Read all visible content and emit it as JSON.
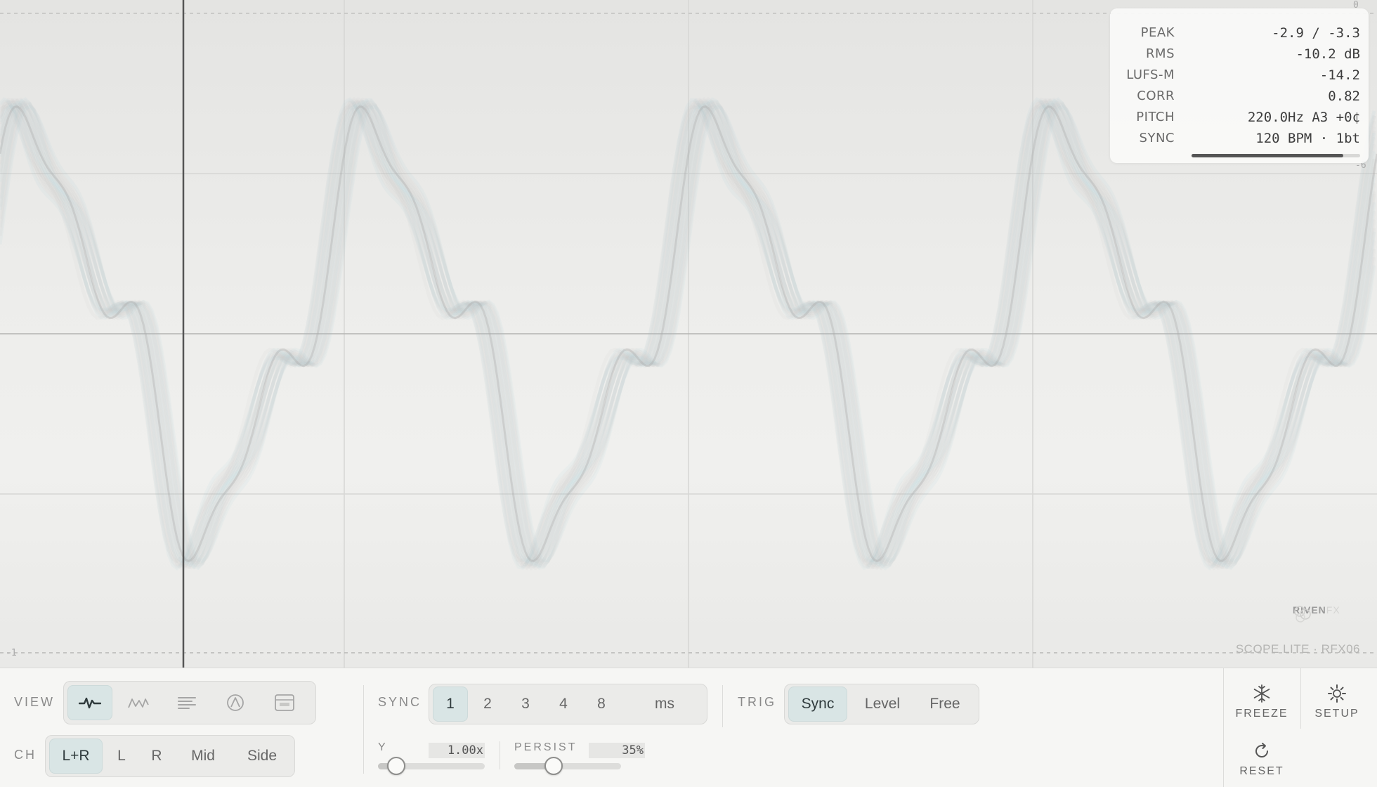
{
  "scope": {
    "scale_top": "0",
    "scale_upper_right": "-6",
    "scale_bottom_left": "-1",
    "waveform_color": "#b9b9b9",
    "accent_color": "#9fcfd3"
  },
  "meter": {
    "rows": [
      {
        "key": "PEAK",
        "value": "-2.9 / -3.3"
      },
      {
        "key": "RMS",
        "value": "-10.2 dB"
      },
      {
        "key": "LUFS-M",
        "value": "-14.2"
      },
      {
        "key": "CORR",
        "value": "0.82"
      },
      {
        "key": "PITCH",
        "value": "220.0Hz A3 +0¢"
      },
      {
        "key": "SYNC",
        "value": "120 BPM · 1bt"
      }
    ],
    "level_fraction": 0.9
  },
  "brand": {
    "name": "RIVEN",
    "suffix": "FX"
  },
  "product": "SCOPE LITE · RFX06",
  "toolbar": {
    "view_label": "VIEW",
    "view_icons": [
      {
        "name": "waveform-icon",
        "active": true
      },
      {
        "name": "peaks-icon",
        "active": false
      },
      {
        "name": "lines-icon",
        "active": false
      },
      {
        "name": "phase-icon",
        "active": false
      },
      {
        "name": "window-icon",
        "active": false
      }
    ],
    "ch_label": "CH",
    "channels": [
      {
        "label": "L+R",
        "active": true
      },
      {
        "label": "L",
        "active": false
      },
      {
        "label": "R",
        "active": false
      },
      {
        "label": "Mid",
        "active": false
      },
      {
        "label": "Side",
        "active": false
      }
    ],
    "sync_label": "SYNC",
    "sync_options": [
      {
        "label": "1",
        "active": true
      },
      {
        "label": "2",
        "active": false
      },
      {
        "label": "3",
        "active": false
      },
      {
        "label": "4",
        "active": false
      },
      {
        "label": "8",
        "active": false
      },
      {
        "label": "ms",
        "active": false
      }
    ],
    "trig_label": "TRIG",
    "trig_options": [
      {
        "label": "Sync",
        "active": true
      },
      {
        "label": "Level",
        "active": false
      },
      {
        "label": "Free",
        "active": false
      }
    ],
    "y_label": "Y",
    "y_value": "1.00x",
    "y_fraction": 0.17,
    "persist_label": "PERSIST",
    "persist_value": "35%",
    "persist_fraction": 0.37,
    "freeze_label": "FREEZE",
    "setup_label": "SETUP",
    "reset_label": "RESET"
  }
}
